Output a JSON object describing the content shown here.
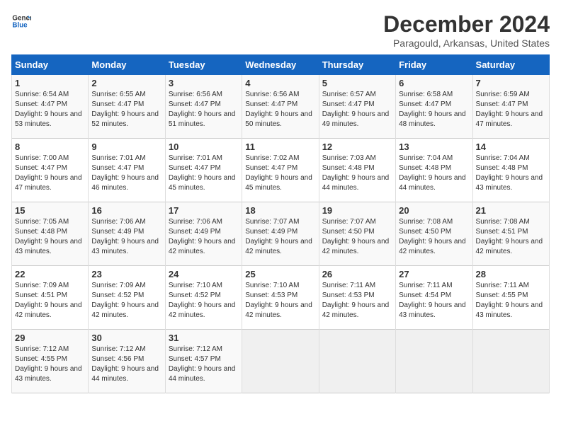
{
  "logo": {
    "line1": "General",
    "line2": "Blue"
  },
  "title": "December 2024",
  "location": "Paragould, Arkansas, United States",
  "days_of_week": [
    "Sunday",
    "Monday",
    "Tuesday",
    "Wednesday",
    "Thursday",
    "Friday",
    "Saturday"
  ],
  "weeks": [
    [
      {
        "day": "1",
        "sunrise": "Sunrise: 6:54 AM",
        "sunset": "Sunset: 4:47 PM",
        "daylight": "Daylight: 9 hours and 53 minutes."
      },
      {
        "day": "2",
        "sunrise": "Sunrise: 6:55 AM",
        "sunset": "Sunset: 4:47 PM",
        "daylight": "Daylight: 9 hours and 52 minutes."
      },
      {
        "day": "3",
        "sunrise": "Sunrise: 6:56 AM",
        "sunset": "Sunset: 4:47 PM",
        "daylight": "Daylight: 9 hours and 51 minutes."
      },
      {
        "day": "4",
        "sunrise": "Sunrise: 6:56 AM",
        "sunset": "Sunset: 4:47 PM",
        "daylight": "Daylight: 9 hours and 50 minutes."
      },
      {
        "day": "5",
        "sunrise": "Sunrise: 6:57 AM",
        "sunset": "Sunset: 4:47 PM",
        "daylight": "Daylight: 9 hours and 49 minutes."
      },
      {
        "day": "6",
        "sunrise": "Sunrise: 6:58 AM",
        "sunset": "Sunset: 4:47 PM",
        "daylight": "Daylight: 9 hours and 48 minutes."
      },
      {
        "day": "7",
        "sunrise": "Sunrise: 6:59 AM",
        "sunset": "Sunset: 4:47 PM",
        "daylight": "Daylight: 9 hours and 47 minutes."
      }
    ],
    [
      {
        "day": "8",
        "sunrise": "Sunrise: 7:00 AM",
        "sunset": "Sunset: 4:47 PM",
        "daylight": "Daylight: 9 hours and 47 minutes."
      },
      {
        "day": "9",
        "sunrise": "Sunrise: 7:01 AM",
        "sunset": "Sunset: 4:47 PM",
        "daylight": "Daylight: 9 hours and 46 minutes."
      },
      {
        "day": "10",
        "sunrise": "Sunrise: 7:01 AM",
        "sunset": "Sunset: 4:47 PM",
        "daylight": "Daylight: 9 hours and 45 minutes."
      },
      {
        "day": "11",
        "sunrise": "Sunrise: 7:02 AM",
        "sunset": "Sunset: 4:47 PM",
        "daylight": "Daylight: 9 hours and 45 minutes."
      },
      {
        "day": "12",
        "sunrise": "Sunrise: 7:03 AM",
        "sunset": "Sunset: 4:48 PM",
        "daylight": "Daylight: 9 hours and 44 minutes."
      },
      {
        "day": "13",
        "sunrise": "Sunrise: 7:04 AM",
        "sunset": "Sunset: 4:48 PM",
        "daylight": "Daylight: 9 hours and 44 minutes."
      },
      {
        "day": "14",
        "sunrise": "Sunrise: 7:04 AM",
        "sunset": "Sunset: 4:48 PM",
        "daylight": "Daylight: 9 hours and 43 minutes."
      }
    ],
    [
      {
        "day": "15",
        "sunrise": "Sunrise: 7:05 AM",
        "sunset": "Sunset: 4:48 PM",
        "daylight": "Daylight: 9 hours and 43 minutes."
      },
      {
        "day": "16",
        "sunrise": "Sunrise: 7:06 AM",
        "sunset": "Sunset: 4:49 PM",
        "daylight": "Daylight: 9 hours and 43 minutes."
      },
      {
        "day": "17",
        "sunrise": "Sunrise: 7:06 AM",
        "sunset": "Sunset: 4:49 PM",
        "daylight": "Daylight: 9 hours and 42 minutes."
      },
      {
        "day": "18",
        "sunrise": "Sunrise: 7:07 AM",
        "sunset": "Sunset: 4:49 PM",
        "daylight": "Daylight: 9 hours and 42 minutes."
      },
      {
        "day": "19",
        "sunrise": "Sunrise: 7:07 AM",
        "sunset": "Sunset: 4:50 PM",
        "daylight": "Daylight: 9 hours and 42 minutes."
      },
      {
        "day": "20",
        "sunrise": "Sunrise: 7:08 AM",
        "sunset": "Sunset: 4:50 PM",
        "daylight": "Daylight: 9 hours and 42 minutes."
      },
      {
        "day": "21",
        "sunrise": "Sunrise: 7:08 AM",
        "sunset": "Sunset: 4:51 PM",
        "daylight": "Daylight: 9 hours and 42 minutes."
      }
    ],
    [
      {
        "day": "22",
        "sunrise": "Sunrise: 7:09 AM",
        "sunset": "Sunset: 4:51 PM",
        "daylight": "Daylight: 9 hours and 42 minutes."
      },
      {
        "day": "23",
        "sunrise": "Sunrise: 7:09 AM",
        "sunset": "Sunset: 4:52 PM",
        "daylight": "Daylight: 9 hours and 42 minutes."
      },
      {
        "day": "24",
        "sunrise": "Sunrise: 7:10 AM",
        "sunset": "Sunset: 4:52 PM",
        "daylight": "Daylight: 9 hours and 42 minutes."
      },
      {
        "day": "25",
        "sunrise": "Sunrise: 7:10 AM",
        "sunset": "Sunset: 4:53 PM",
        "daylight": "Daylight: 9 hours and 42 minutes."
      },
      {
        "day": "26",
        "sunrise": "Sunrise: 7:11 AM",
        "sunset": "Sunset: 4:53 PM",
        "daylight": "Daylight: 9 hours and 42 minutes."
      },
      {
        "day": "27",
        "sunrise": "Sunrise: 7:11 AM",
        "sunset": "Sunset: 4:54 PM",
        "daylight": "Daylight: 9 hours and 43 minutes."
      },
      {
        "day": "28",
        "sunrise": "Sunrise: 7:11 AM",
        "sunset": "Sunset: 4:55 PM",
        "daylight": "Daylight: 9 hours and 43 minutes."
      }
    ],
    [
      {
        "day": "29",
        "sunrise": "Sunrise: 7:12 AM",
        "sunset": "Sunset: 4:55 PM",
        "daylight": "Daylight: 9 hours and 43 minutes."
      },
      {
        "day": "30",
        "sunrise": "Sunrise: 7:12 AM",
        "sunset": "Sunset: 4:56 PM",
        "daylight": "Daylight: 9 hours and 44 minutes."
      },
      {
        "day": "31",
        "sunrise": "Sunrise: 7:12 AM",
        "sunset": "Sunset: 4:57 PM",
        "daylight": "Daylight: 9 hours and 44 minutes."
      },
      null,
      null,
      null,
      null
    ]
  ]
}
